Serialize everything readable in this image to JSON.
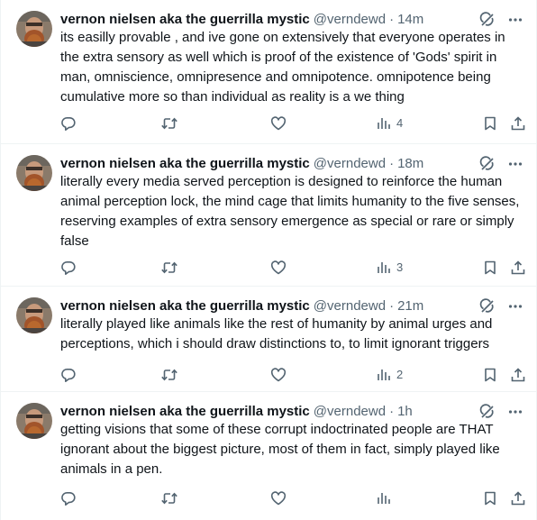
{
  "colors": {
    "text": "#0f1419",
    "secondary": "#536471",
    "divider": "#eff3f4"
  },
  "tweets": [
    {
      "author": "vernon nielsen aka the guerrilla mystic",
      "handle": "@verndewd",
      "separator": "·",
      "time": "14m",
      "text": "its easilly provable , and ive gone on extensively that everyone operates in the extra sensory as well which is proof of the existence of 'Gods' spirit in man, omniscience, omnipresence and omnipotence. omnipotence being cumulative more so than individual as reality is a we thing",
      "views": "4"
    },
    {
      "author": "vernon nielsen aka the guerrilla mystic",
      "handle": "@verndewd",
      "separator": "·",
      "time": "18m",
      "text": "literally every media served perception is designed to reinforce the human animal perception lock, the mind cage that limits humanity to the five senses, reserving examples of extra sensory emergence as special or rare or simply false",
      "views": "3"
    },
    {
      "author": "vernon nielsen aka the guerrilla mystic",
      "handle": "@verndewd",
      "separator": "·",
      "time": "21m",
      "text": "literally played like animals like the rest of humanity by animal urges and perceptions, which i should draw distinctions to, to limit ignorant triggers",
      "views": "2"
    },
    {
      "author": "vernon nielsen aka the guerrilla mystic",
      "handle": "@verndewd",
      "separator": "·",
      "time": "1h",
      "text": "getting visions that some of these corrupt indoctrinated people are THAT ignorant about the biggest picture, most of them in fact, simply played like animals in a pen.",
      "views": ""
    }
  ],
  "icons": {
    "avatar": "avatar-photo",
    "grok": "grok-icon",
    "more": "more-icon",
    "reply": "reply-icon",
    "retweet": "retweet-icon",
    "like": "like-icon",
    "views": "views-icon",
    "bookmark": "bookmark-icon",
    "share": "share-icon"
  }
}
